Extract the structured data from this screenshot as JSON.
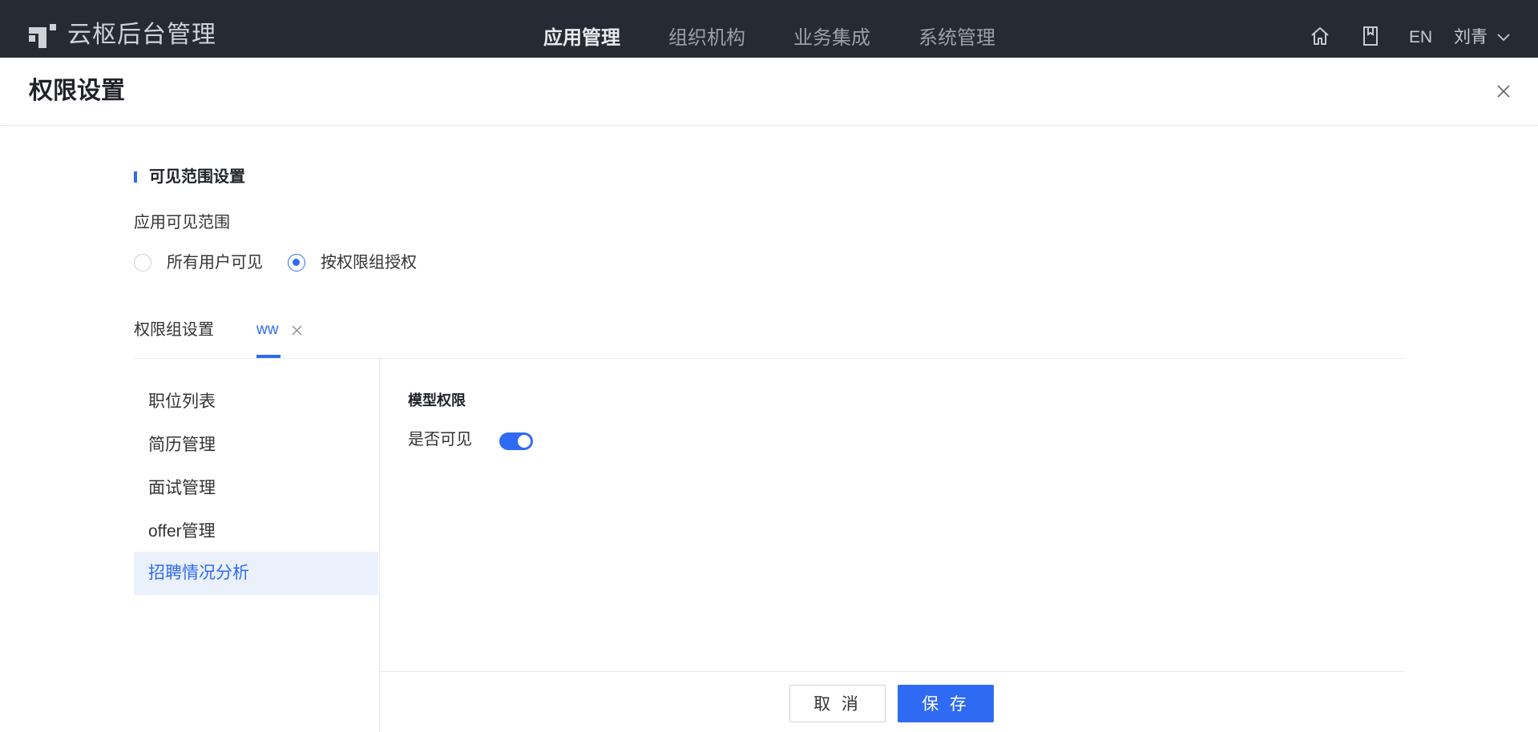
{
  "app": {
    "title": "云枢后台管理"
  },
  "nav": {
    "items": [
      {
        "label": "应用管理",
        "active": true
      },
      {
        "label": "组织机构",
        "active": false
      },
      {
        "label": "业务集成",
        "active": false
      },
      {
        "label": "系统管理",
        "active": false
      }
    ]
  },
  "topbar": {
    "icons": [
      "home-icon",
      "book-icon"
    ],
    "lang": "EN",
    "user": "刘青"
  },
  "page": {
    "title": "权限设置"
  },
  "visibility": {
    "section_title": "可见范围设置",
    "field_label": "应用可见范围",
    "options": [
      {
        "label": "所有用户可见",
        "checked": false
      },
      {
        "label": "按权限组授权",
        "checked": true
      }
    ]
  },
  "groups": {
    "label": "权限组设置",
    "tabs": [
      {
        "label": "ww",
        "active": true
      }
    ]
  },
  "menu": {
    "items": [
      {
        "label": "职位列表",
        "active": false
      },
      {
        "label": "简历管理",
        "active": false
      },
      {
        "label": "面试管理",
        "active": false
      },
      {
        "label": "offer管理",
        "active": false
      },
      {
        "label": "招聘情况分析",
        "active": true
      }
    ]
  },
  "content": {
    "section_title": "模型权限",
    "visible_label": "是否可见",
    "visible_on": true
  },
  "footer": {
    "cancel_label": "取 消",
    "save_label": "保 存"
  },
  "colors": {
    "accent": "#2f6bf2",
    "topbar": "#262b33"
  }
}
